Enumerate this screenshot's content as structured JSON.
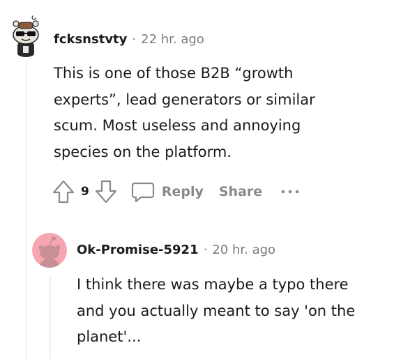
{
  "comments": [
    {
      "author": "fcksnstvty",
      "separator": "·",
      "time": "22 hr. ago",
      "lines": [
        "This is one of those B2B “growth",
        "experts”, lead generators or similar",
        "scum. Most useless and annoying",
        "species on the platform."
      ],
      "score": "9",
      "reply_label": "Reply",
      "share_label": "Share"
    },
    {
      "author": "Ok-Promise-5921",
      "separator": "·",
      "time": "20 hr. ago",
      "lines": [
        "I think there was maybe a typo there",
        "and you actually meant to say 'on the",
        "planet'..."
      ]
    }
  ],
  "icons": {
    "upvote": "arrow-up-icon",
    "downvote": "arrow-down-icon",
    "reply": "speech-bubble-icon",
    "more": "ellipsis-icon",
    "avatar_default_color": "#f6a6b0"
  }
}
